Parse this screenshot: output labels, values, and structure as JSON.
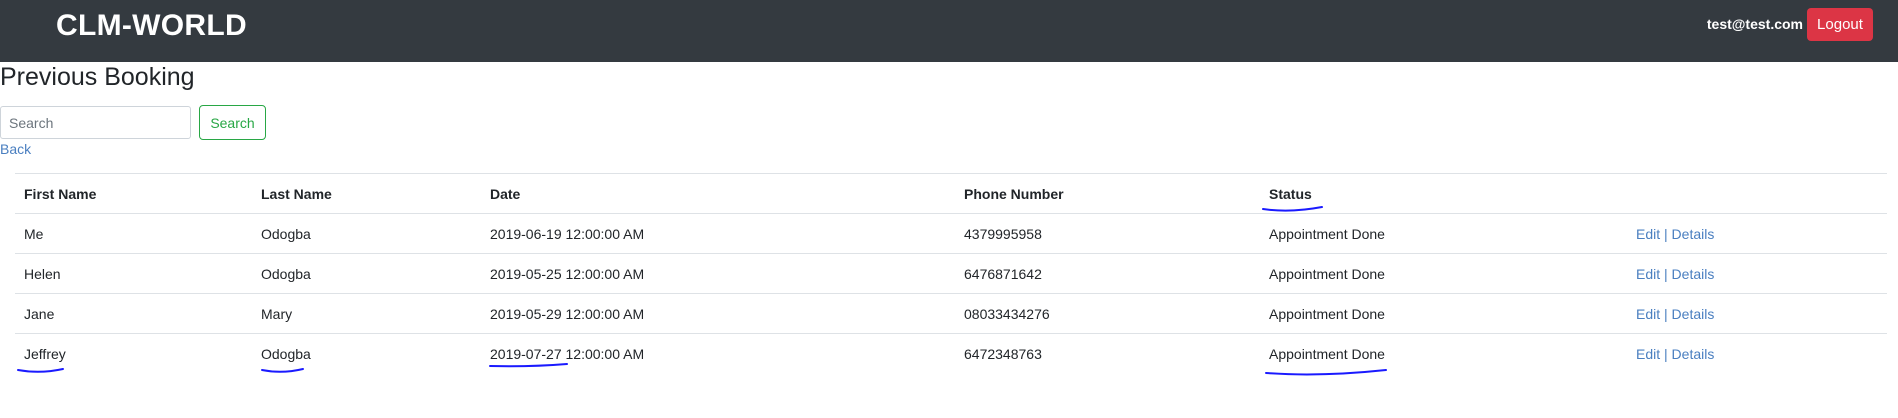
{
  "navbar": {
    "brand": "CLM-WORLD",
    "user_email": "test@test.com",
    "logout_label": "Logout"
  },
  "page": {
    "title": "Previous Booking"
  },
  "search": {
    "placeholder": "Search",
    "value": "",
    "button_label": "Search"
  },
  "back_label": "Back",
  "table": {
    "headers": [
      "First Name",
      "Last Name",
      "Date",
      "Phone Number",
      "Status",
      ""
    ],
    "rows": [
      {
        "first": "Me",
        "last": "Odogba",
        "date": "2019-06-19 12:00:00 AM",
        "phone": "4379995958",
        "status": "Appointment Done",
        "edit": "Edit",
        "sep": "|",
        "details": "Details"
      },
      {
        "first": "Helen",
        "last": "Odogba",
        "date": "2019-05-25 12:00:00 AM",
        "phone": "6476871642",
        "status": "Appointment Done",
        "edit": "Edit",
        "sep": "|",
        "details": "Details"
      },
      {
        "first": "Jane",
        "last": "Mary",
        "date": "2019-05-29 12:00:00 AM",
        "phone": "08033434276",
        "status": "Appointment Done",
        "edit": "Edit",
        "sep": "|",
        "details": "Details"
      },
      {
        "first": "Jeffrey",
        "last": "Odogba",
        "date": "2019-07-27 12:00:00 AM",
        "phone": "6472348763",
        "status": "Appointment Done",
        "edit": "Edit",
        "sep": "|",
        "details": "Details"
      }
    ]
  },
  "colors": {
    "navbar_bg": "#343a40",
    "logout_bg": "#dc3545",
    "search_outline": "#28a745",
    "link": "#4a7fc0",
    "annotation_ink": "#1a1aff"
  }
}
